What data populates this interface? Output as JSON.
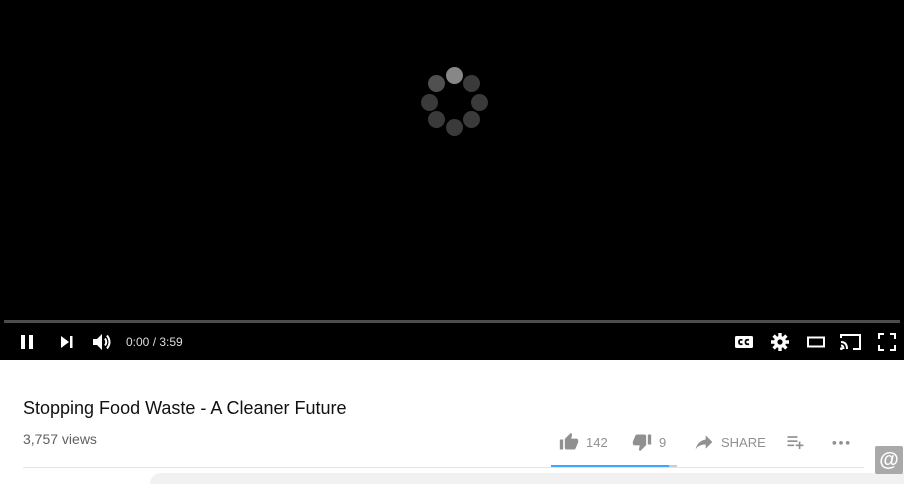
{
  "player": {
    "loading_icon": "loading-spinner-icon",
    "progress": 0,
    "time_current": "0:00",
    "time_separator": " / ",
    "time_duration": "3:59",
    "controls_left": [
      "pause-icon",
      "next-icon",
      "volume-icon"
    ],
    "controls_right": [
      "subtitles-icon",
      "settings-icon",
      "theater-mode-icon",
      "cast-icon",
      "fullscreen-icon"
    ]
  },
  "video": {
    "title": "Stopping Food Waste - A Cleaner Future",
    "views": "3,757 views"
  },
  "actions": {
    "like_count": "142",
    "dislike_count": "9",
    "share_label": "SHARE",
    "save_icon": "add-to-playlist-icon",
    "more_icon": "more-icon",
    "like_ratio": 0.94
  },
  "corner_badge": "@",
  "colors": {
    "player_bg": "#000000",
    "sentiment_bar": "#3ea6ff",
    "action_text": "#909090"
  }
}
